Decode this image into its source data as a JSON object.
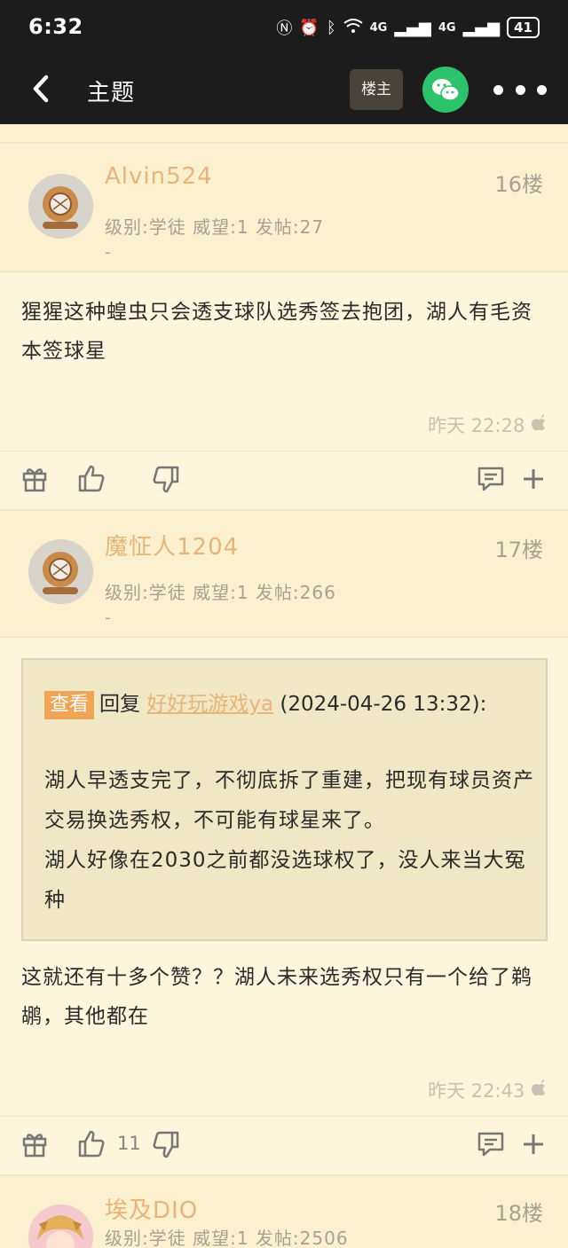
{
  "statusbar": {
    "time": "6:32",
    "battery": "41",
    "signal1": "4G",
    "signal2": "4G"
  },
  "nav": {
    "title": "主题",
    "op_label": "楼主"
  },
  "posts": [
    {
      "username": "Alvin524",
      "meta": "级别:学徒  威望:1  发帖:27",
      "sub": "-",
      "floor": "16楼",
      "content": "猩猩这种蝗虫只会透支球队选秀签去抱团，湖人有毛资本签球星",
      "time": "昨天 22:28",
      "likes": ""
    },
    {
      "username": "魔怔人1204",
      "meta": "级别:学徒  威望:1  发帖:266",
      "sub": "-",
      "floor": "17楼",
      "quote": {
        "tag": "查看",
        "reply_label": "回复",
        "reply_user": "好好玩游戏ya",
        "reply_time": "(2024-04-26 13:32):",
        "text": "湖人早透支完了，不彻底拆了重建，把现有球员资产交易换选秀权，不可能有球星来了。\n湖人好像在2030之前都没选球权了，没人来当大冤种"
      },
      "content": "这就还有十多个赞？？湖人未来选秀权只有一个给了鹈鹕，其他都在",
      "time": "昨天 22:43",
      "likes": "11"
    },
    {
      "username": "埃及DIO",
      "meta": "级别:学徒  威望:1  发帖:2506",
      "floor": "18楼"
    }
  ]
}
